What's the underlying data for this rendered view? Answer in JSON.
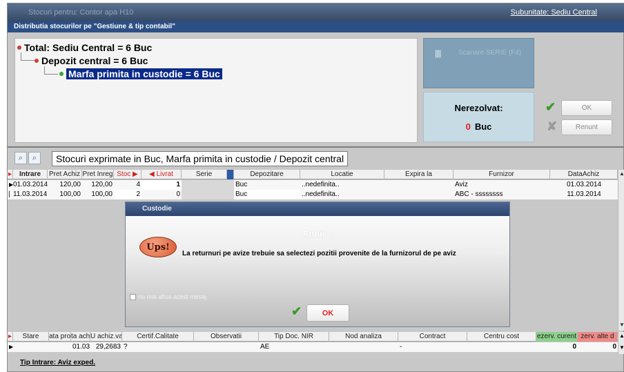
{
  "window": {
    "title": "Stocuri pentru: Contor apa H10",
    "subunit_link": "Subunitate: Sediu Central",
    "distribution_label": "Distributia stocurilor pe \"Gestiune & tip contabil\""
  },
  "tree": {
    "total": "Total: Sediu Central = 6 Buc",
    "depot": "Depozit central = 6 Buc",
    "custody": "Marfa primita in custodie = 6 Buc"
  },
  "serie_button": {
    "bars": "||||",
    "label": "Scanare SERIE (F4)"
  },
  "unresolved": {
    "label": "Nerezolvat:",
    "count": "0",
    "unit": "Buc"
  },
  "buttons": {
    "ok": "OK",
    "cancel": "Renunt"
  },
  "caption": "Stocuri exprimate in Buc, Marfa primita in custodie / Depozit central",
  "grid": {
    "headers": [
      "Intrare",
      "Pret Achiz",
      "Pret Inreg",
      "Stoc",
      "Livrat",
      "Serie",
      "Depozitare",
      "Locatie",
      "Expira la",
      "Furnizor",
      "DataAchiz"
    ],
    "rows": [
      [
        "01.03.2014",
        "120,00",
        "120,00",
        "4",
        "1",
        "",
        "Buc",
        "..nedefinita..",
        "",
        "Aviz",
        "01.03.2014"
      ],
      [
        "11.03.2014",
        "100,00",
        "100,00",
        "2",
        "0",
        "",
        "Buc",
        "..nedefinita..",
        "",
        "ABC - ssssssss",
        "11.03.2014"
      ]
    ]
  },
  "dialog": {
    "title": "Custodie",
    "heading": "Annie !",
    "badge": "Ups!",
    "message": "La returnuri pe avize trebuie sa selectezi pozitii provenite de la furnizorul de pe aviz",
    "checkbox_label": "nu mai afisa acest mesaj",
    "ok": "OK"
  },
  "grid2": {
    "headers": [
      "Stare",
      "ata pro",
      "ta ach",
      "U achiz.valu",
      "Certif.Calitate",
      "Observatii",
      "Tip Doc. NIR",
      "Nod analiza",
      "Contract",
      "Centru cost",
      "ezerv. curent",
      "zerv. alte d"
    ],
    "row": [
      "",
      "",
      "01.03",
      "29,2683",
      "?",
      "",
      "AE",
      "",
      "-",
      "",
      "0",
      "0"
    ]
  },
  "tip_intrare": "Tip Intrare: Aviz exped."
}
